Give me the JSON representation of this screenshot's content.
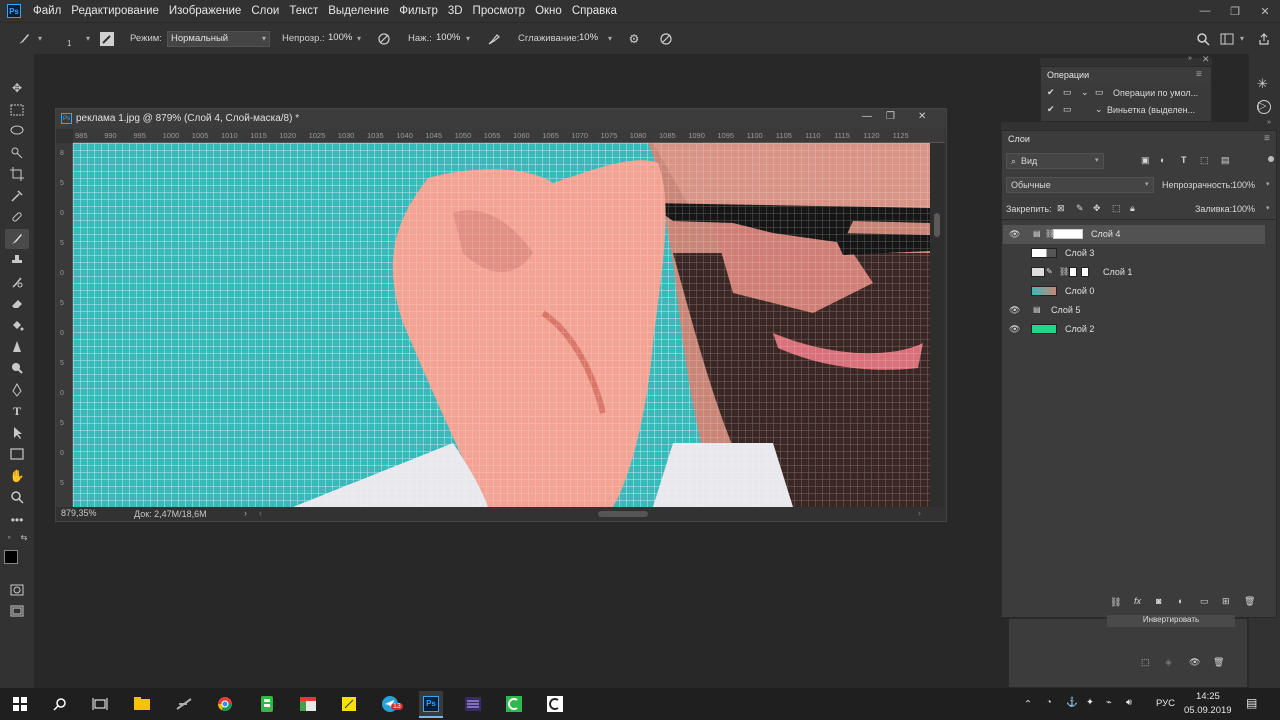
{
  "app": {
    "logo": "Ps"
  },
  "menu": [
    "Файл",
    "Редактирование",
    "Изображение",
    "Слои",
    "Текст",
    "Выделение",
    "Фильтр",
    "3D",
    "Просмотр",
    "Окно",
    "Справка"
  ],
  "window_controls": {
    "minimize": "—",
    "restore": "❐",
    "close": "✕"
  },
  "options_bar": {
    "brush_size": "1",
    "mode_label": "Режим:",
    "mode_value": "Нормальный",
    "opacity_label": "Непрозр.:",
    "opacity_value": "100%",
    "flow_label": "Наж.:",
    "flow_value": "100%",
    "smoothing_label": "Сглаживание:",
    "smoothing_value": "10%"
  },
  "document": {
    "title": "реклама 1.jpg @ 879% (Слой 4, Слой-маска/8) *",
    "zoom": "879,35%",
    "doc_info": "Док: 2,47M/18,6M",
    "ruler_ticks": [
      "985",
      "990",
      "995",
      "1000",
      "1005",
      "1010",
      "1015",
      "1020",
      "1025",
      "1030",
      "1035",
      "1040",
      "1045",
      "1050",
      "1055",
      "1060",
      "1065",
      "1070",
      "1075",
      "1080",
      "1085",
      "1090",
      "1095",
      "1100",
      "1105",
      "1110",
      "1115",
      "1120",
      "1125"
    ]
  },
  "operations_panel": {
    "tab": "Операции",
    "items": [
      "Операции по умол...",
      "Виньетка (выделен..."
    ]
  },
  "layers_panel": {
    "tab": "Слои",
    "filter": "Вид",
    "blend_mode": "Обычные",
    "opacity_label": "Непрозрачность:",
    "opacity_value": "100%",
    "lock_label": "Закрепить:",
    "fill_label": "Заливка:",
    "fill_value": "100%",
    "layers": [
      {
        "name": "Слой 4",
        "visible": true,
        "selected": true
      },
      {
        "name": "Слой 3",
        "visible": false,
        "selected": false
      },
      {
        "name": "Слой 1",
        "visible": false,
        "selected": false
      },
      {
        "name": "Слой 0",
        "visible": false,
        "selected": false
      },
      {
        "name": "Слой 5",
        "visible": true,
        "selected": false
      },
      {
        "name": "Слой 2",
        "visible": true,
        "selected": false
      }
    ]
  },
  "lower_panel": {
    "button": "Инвертировать"
  },
  "taskbar": {
    "lang": "РУС",
    "time": "14:25",
    "date": "05.09.2019",
    "telegram_badge": "13"
  },
  "colors": {
    "canvas": "#39b9ba",
    "accent": "#31a8ff",
    "layer_green": "#1fd68a"
  }
}
